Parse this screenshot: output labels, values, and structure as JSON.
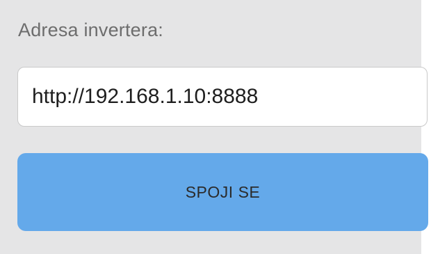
{
  "form": {
    "address_label": "Adresa invertera:",
    "address_value": "http://192.168.1.10:8888",
    "connect_label": "SPOJI SE"
  },
  "colors": {
    "panel_background": "#e5e5e6",
    "button_background": "#64a9ea",
    "input_border": "#c9c9c9"
  }
}
